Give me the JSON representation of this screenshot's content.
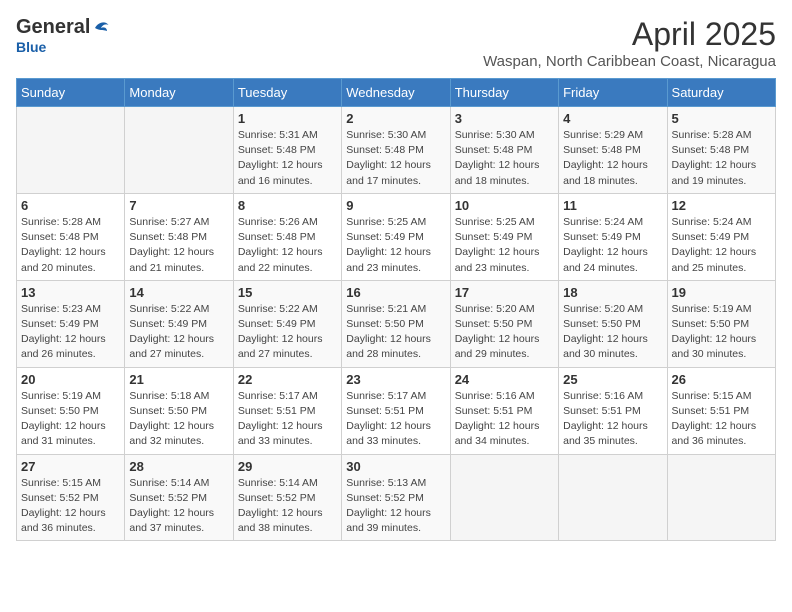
{
  "logo": {
    "general": "General",
    "blue": "Blue"
  },
  "title": {
    "month_year": "April 2025",
    "location": "Waspan, North Caribbean Coast, Nicaragua"
  },
  "weekdays": [
    "Sunday",
    "Monday",
    "Tuesday",
    "Wednesday",
    "Thursday",
    "Friday",
    "Saturday"
  ],
  "weeks": [
    [
      {
        "day": "",
        "detail": ""
      },
      {
        "day": "",
        "detail": ""
      },
      {
        "day": "1",
        "detail": "Sunrise: 5:31 AM\nSunset: 5:48 PM\nDaylight: 12 hours and 16 minutes."
      },
      {
        "day": "2",
        "detail": "Sunrise: 5:30 AM\nSunset: 5:48 PM\nDaylight: 12 hours and 17 minutes."
      },
      {
        "day": "3",
        "detail": "Sunrise: 5:30 AM\nSunset: 5:48 PM\nDaylight: 12 hours and 18 minutes."
      },
      {
        "day": "4",
        "detail": "Sunrise: 5:29 AM\nSunset: 5:48 PM\nDaylight: 12 hours and 18 minutes."
      },
      {
        "day": "5",
        "detail": "Sunrise: 5:28 AM\nSunset: 5:48 PM\nDaylight: 12 hours and 19 minutes."
      }
    ],
    [
      {
        "day": "6",
        "detail": "Sunrise: 5:28 AM\nSunset: 5:48 PM\nDaylight: 12 hours and 20 minutes."
      },
      {
        "day": "7",
        "detail": "Sunrise: 5:27 AM\nSunset: 5:48 PM\nDaylight: 12 hours and 21 minutes."
      },
      {
        "day": "8",
        "detail": "Sunrise: 5:26 AM\nSunset: 5:48 PM\nDaylight: 12 hours and 22 minutes."
      },
      {
        "day": "9",
        "detail": "Sunrise: 5:25 AM\nSunset: 5:49 PM\nDaylight: 12 hours and 23 minutes."
      },
      {
        "day": "10",
        "detail": "Sunrise: 5:25 AM\nSunset: 5:49 PM\nDaylight: 12 hours and 23 minutes."
      },
      {
        "day": "11",
        "detail": "Sunrise: 5:24 AM\nSunset: 5:49 PM\nDaylight: 12 hours and 24 minutes."
      },
      {
        "day": "12",
        "detail": "Sunrise: 5:24 AM\nSunset: 5:49 PM\nDaylight: 12 hours and 25 minutes."
      }
    ],
    [
      {
        "day": "13",
        "detail": "Sunrise: 5:23 AM\nSunset: 5:49 PM\nDaylight: 12 hours and 26 minutes."
      },
      {
        "day": "14",
        "detail": "Sunrise: 5:22 AM\nSunset: 5:49 PM\nDaylight: 12 hours and 27 minutes."
      },
      {
        "day": "15",
        "detail": "Sunrise: 5:22 AM\nSunset: 5:49 PM\nDaylight: 12 hours and 27 minutes."
      },
      {
        "day": "16",
        "detail": "Sunrise: 5:21 AM\nSunset: 5:50 PM\nDaylight: 12 hours and 28 minutes."
      },
      {
        "day": "17",
        "detail": "Sunrise: 5:20 AM\nSunset: 5:50 PM\nDaylight: 12 hours and 29 minutes."
      },
      {
        "day": "18",
        "detail": "Sunrise: 5:20 AM\nSunset: 5:50 PM\nDaylight: 12 hours and 30 minutes."
      },
      {
        "day": "19",
        "detail": "Sunrise: 5:19 AM\nSunset: 5:50 PM\nDaylight: 12 hours and 30 minutes."
      }
    ],
    [
      {
        "day": "20",
        "detail": "Sunrise: 5:19 AM\nSunset: 5:50 PM\nDaylight: 12 hours and 31 minutes."
      },
      {
        "day": "21",
        "detail": "Sunrise: 5:18 AM\nSunset: 5:50 PM\nDaylight: 12 hours and 32 minutes."
      },
      {
        "day": "22",
        "detail": "Sunrise: 5:17 AM\nSunset: 5:51 PM\nDaylight: 12 hours and 33 minutes."
      },
      {
        "day": "23",
        "detail": "Sunrise: 5:17 AM\nSunset: 5:51 PM\nDaylight: 12 hours and 33 minutes."
      },
      {
        "day": "24",
        "detail": "Sunrise: 5:16 AM\nSunset: 5:51 PM\nDaylight: 12 hours and 34 minutes."
      },
      {
        "day": "25",
        "detail": "Sunrise: 5:16 AM\nSunset: 5:51 PM\nDaylight: 12 hours and 35 minutes."
      },
      {
        "day": "26",
        "detail": "Sunrise: 5:15 AM\nSunset: 5:51 PM\nDaylight: 12 hours and 36 minutes."
      }
    ],
    [
      {
        "day": "27",
        "detail": "Sunrise: 5:15 AM\nSunset: 5:52 PM\nDaylight: 12 hours and 36 minutes."
      },
      {
        "day": "28",
        "detail": "Sunrise: 5:14 AM\nSunset: 5:52 PM\nDaylight: 12 hours and 37 minutes."
      },
      {
        "day": "29",
        "detail": "Sunrise: 5:14 AM\nSunset: 5:52 PM\nDaylight: 12 hours and 38 minutes."
      },
      {
        "day": "30",
        "detail": "Sunrise: 5:13 AM\nSunset: 5:52 PM\nDaylight: 12 hours and 39 minutes."
      },
      {
        "day": "",
        "detail": ""
      },
      {
        "day": "",
        "detail": ""
      },
      {
        "day": "",
        "detail": ""
      }
    ]
  ]
}
